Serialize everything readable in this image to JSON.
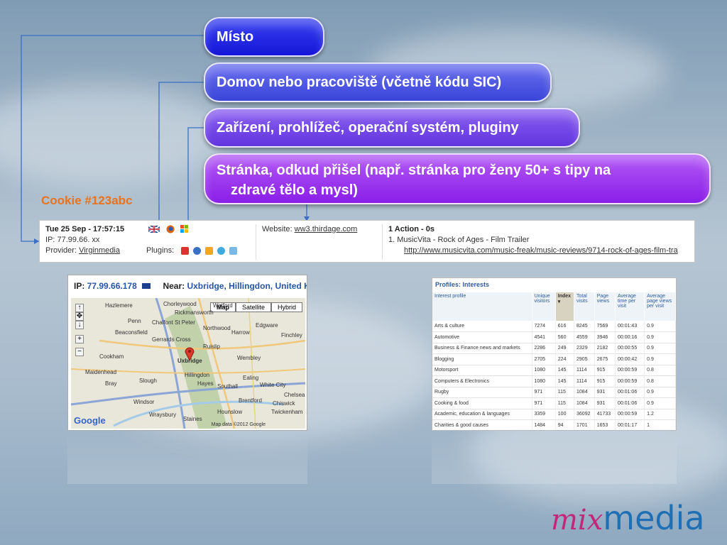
{
  "pills": [
    "Místo",
    "Domov nebo pracoviště (včetně kódu SIC)",
    "Zařízení, prohlížeč, operační systém, pluginy",
    [
      "Stránka, odkud přišel (např. stránka pro ženy 50+ s tipy na",
      "zdravé tělo a mysl)"
    ]
  ],
  "cookie": "Cookie #123abc",
  "visit": {
    "datetime": "Tue 25 Sep - 17:57:15",
    "ip": "IP: 77.99.66. xx",
    "provider_label": "Provider: ",
    "provider": "Virginmedia",
    "plugins_label": "Plugins:",
    "website_label": "Website: ",
    "website": "ww3.thirdage.com",
    "actions": "1 Action - 0s",
    "action_1": "1. MusicVita - Rock of Ages - Film Trailer",
    "action_url": "http://www.musicvita.com/music-freak/music-reviews/9714-rock-of-ages-film-tra"
  },
  "map": {
    "ip_label": "IP: ",
    "ip": "77.99.66.178",
    "near_label": "Near: ",
    "near": "Uxbridge, Hillingdon, United Kingdom",
    "tabs": [
      "Map",
      "Satellite",
      "Hybrid"
    ],
    "places": [
      "Hazlemere",
      "Chorleywood",
      "Watford",
      "Rickmansworth",
      "Penn",
      "Chalfont St Peter",
      "Beaconsfield",
      "Northwood",
      "Harrow",
      "Edgware",
      "Gerrards Cross",
      "Ruislip",
      "Finchley",
      "Cookham",
      "Uxbridge",
      "Wembley",
      "Maidenhead",
      "Bray",
      "Slough",
      "Hillingdon",
      "Hayes",
      "Southall",
      "Ealing",
      "White City",
      "Windsor",
      "Brentford",
      "Chelsea",
      "Hounslow",
      "Wraysbury",
      "Staines",
      "Twickenham",
      "Chiswick"
    ],
    "copyright": "Map data ©2012 Google",
    "google": "Google"
  },
  "profiles": {
    "title": "Profiles: Interests",
    "headers": [
      "Interest profile",
      "Unique visitors",
      "Index ▾",
      "Total visits",
      "Page views",
      "Average time per visit",
      "Average page views per visit"
    ],
    "rows": [
      [
        "Arts & culture",
        "7274",
        "616",
        "8245",
        "7569",
        "00:01:43",
        "0.9"
      ],
      [
        "Automotive",
        "4541",
        "560",
        "4559",
        "3946",
        "00:00:16",
        "0.9"
      ],
      [
        "Business & Finance news and markets",
        "2286",
        "249",
        "2329",
        "2182",
        "00:00:55",
        "0.9"
      ],
      [
        "Blogging",
        "2705",
        "224",
        "2905",
        "2675",
        "00:00:42",
        "0.9"
      ],
      [
        "Motorsport",
        "1080",
        "145",
        "1114",
        "915",
        "00:00:59",
        "0.8"
      ],
      [
        "Computers & Electronics",
        "1080",
        "145",
        "1114",
        "915",
        "00:00:59",
        "0.8"
      ],
      [
        "Rugby",
        "971",
        "115",
        "1084",
        "931",
        "00:01:06",
        "0.9"
      ],
      [
        "Cooking & food",
        "971",
        "115",
        "1084",
        "931",
        "00:01:06",
        "0.9"
      ],
      [
        "Academic, education & languages",
        "3359",
        "100",
        "36092",
        "41733",
        "00:00:59",
        "1.2"
      ],
      [
        "Charities & good causes",
        "1484",
        "94",
        "1701",
        "1653",
        "00:01:17",
        "1"
      ]
    ]
  },
  "logo": {
    "mix": "mix",
    "media": "media"
  },
  "colors": {
    "pill_blue": "#1515d8",
    "pill_violet": "#8a1ee8",
    "cookie": "#e8731c",
    "link": "#2755a8"
  }
}
